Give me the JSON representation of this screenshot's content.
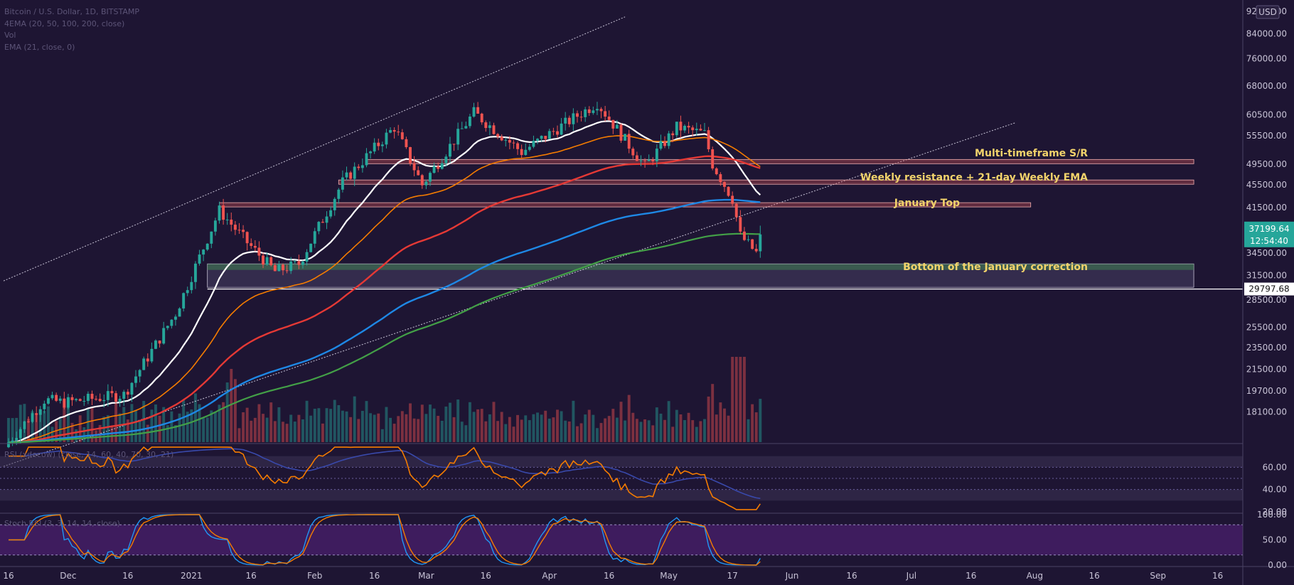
{
  "header": {
    "symbol": "Bitcoin / U.S. Dollar, 1D, BITSTAMP",
    "ema_ribbon": "4EMA (20, 50, 100, 200, close)",
    "volume": "Vol",
    "ema21": "EMA (21, close, 0)"
  },
  "currency": "USD",
  "price_scale": [
    "92000.00",
    "84000.00",
    "76000.00",
    "68000.00",
    "60500.00",
    "55500.00",
    "49500.00",
    "45500.00",
    "41500.00",
    "34500.00",
    "31500.00",
    "28500.00",
    "25500.00",
    "23500.00",
    "21500.00",
    "19700.00",
    "18100.00"
  ],
  "price_scale_values": [
    92000,
    84000,
    76000,
    68000,
    60500,
    55500,
    49500,
    45500,
    41500,
    34500,
    31500,
    28500,
    25500,
    23500,
    21500,
    19700,
    18100
  ],
  "last_price": "37199.64",
  "countdown": "12:54:40",
  "support_price": "29797.68",
  "time_labels": [
    "16",
    "Dec",
    "16",
    "2021",
    "16",
    "Feb",
    "16",
    "Mar",
    "16",
    "Apr",
    "16",
    "May",
    "17",
    "Jun",
    "16",
    "Jul",
    "16",
    "Aug",
    "16",
    "Sep",
    "16"
  ],
  "annotations": {
    "mtf": "Multi-timeframe S/R",
    "weekly": "Weekly resistance + 21-day Weekly EMA",
    "jan_top": "January Top",
    "jan_bottom": "Bottom of the January correction"
  },
  "rsi": {
    "label": "RSI (xdecow) (close, 14, 60, 40, 70, 30, 21)",
    "scale": [
      "60.00",
      "40.00",
      "20.00"
    ],
    "scale_values": [
      60,
      40,
      20
    ]
  },
  "stoch": {
    "label": "Stoch RSI (3, 3, 14, 14, close)",
    "scale": [
      "100.00",
      "50.00",
      "0.00"
    ],
    "scale_values": [
      100,
      50,
      0
    ]
  },
  "colors": {
    "bull": "#26a69a",
    "bear": "#ef5350",
    "ema20": "#ffffff",
    "ema50": "#f57c00",
    "ema100": "#e53935",
    "ema200": "#1e88e5",
    "ema21w": "#43a047",
    "annotation": "#f2d36b",
    "last_price_bg": "#26a69a"
  },
  "chart_data": {
    "type": "candlestick",
    "title": "Bitcoin / U.S. Dollar, 1D, BITSTAMP",
    "x_range": [
      "2020-11-16",
      "2021-09-20"
    ],
    "y_range": [
      16000,
      95000
    ],
    "y_scale": "log",
    "anchors": [
      [
        "2020-11-16",
        16000
      ],
      [
        "2020-11-25",
        19000
      ],
      [
        "2020-11-30",
        18800
      ],
      [
        "2020-12-15",
        19400
      ],
      [
        "2020-12-28",
        27000
      ],
      [
        "2021-01-08",
        41000
      ],
      [
        "2021-01-15",
        36000
      ],
      [
        "2021-01-22",
        32000
      ],
      [
        "2021-01-28",
        33000
      ],
      [
        "2021-02-08",
        46000
      ],
      [
        "2021-02-21",
        57500
      ],
      [
        "2021-02-28",
        45500
      ],
      [
        "2021-03-13",
        61000
      ],
      [
        "2021-03-25",
        52000
      ],
      [
        "2021-04-13",
        63500
      ],
      [
        "2021-04-25",
        49000
      ],
      [
        "2021-05-03",
        57500
      ],
      [
        "2021-05-10",
        56000
      ],
      [
        "2021-05-12",
        49500
      ],
      [
        "2021-05-17",
        43000
      ],
      [
        "2021-05-19",
        37000
      ],
      [
        "2021-05-23",
        34500
      ],
      [
        "2021-05-24",
        37199.64
      ]
    ],
    "horizontal_levels": [
      {
        "label": "Multi-timeframe S/R",
        "value": 50000
      },
      {
        "label": "Weekly resistance + 21-day Weekly EMA",
        "value": 46000
      },
      {
        "label": "January Top",
        "value": 41950
      },
      {
        "label": "Bottom of the January correction",
        "range": [
          30000,
          33000
        ]
      },
      {
        "label": "29797.68",
        "value": 29797.68
      }
    ],
    "last_price": 37199.64,
    "rsi_range": [
      20,
      80
    ],
    "rsi_levels": [
      60,
      50,
      40
    ],
    "stoch_range": [
      0,
      100
    ],
    "stoch_levels": [
      80,
      20
    ]
  }
}
